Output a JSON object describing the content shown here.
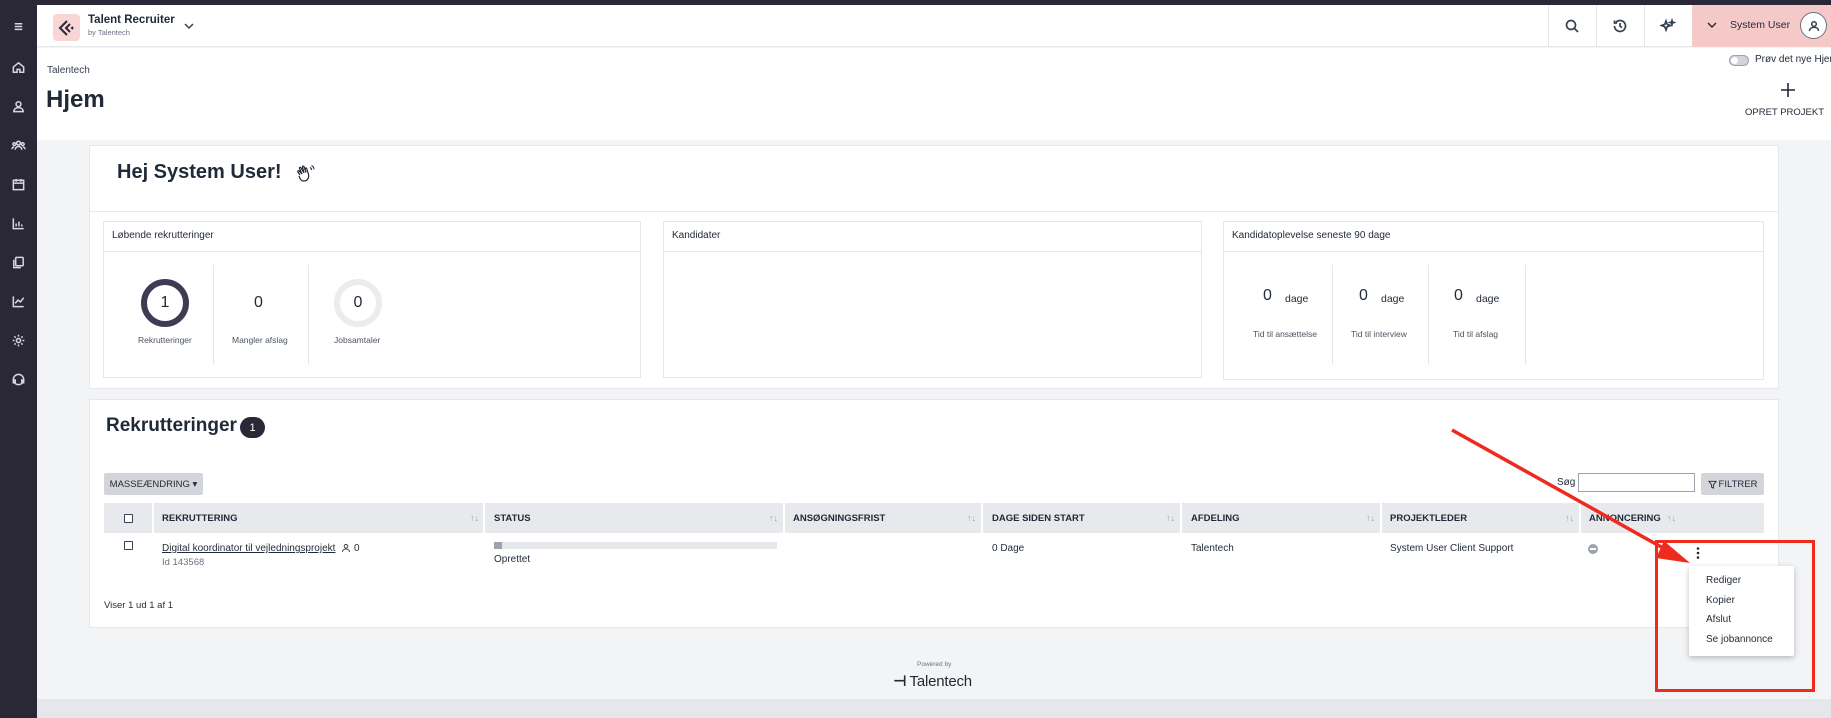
{
  "app": {
    "name": "Talent Recruiter",
    "sub": "by Talentech",
    "user_name": "System User"
  },
  "header": {
    "breadcrumb": "Talentech",
    "title": "Hjem",
    "toggle_label": "Prøv det nye Hjem",
    "create_label": "OPRET PROJEKT"
  },
  "welcome": {
    "greeting": "Hej System User!",
    "panels": {
      "ongoing": {
        "title": "Løbende rekrutteringer",
        "recruitments_value": "1",
        "recruitments_label": "Rekrutteringer",
        "missing_value": "0",
        "missing_label": "Mangler afslag",
        "interviews_value": "0",
        "interviews_label": "Jobsamtaler"
      },
      "candidates": {
        "title": "Kandidater"
      },
      "experience": {
        "title": "Kandidatoplevelse seneste 90 dage",
        "stats": [
          {
            "value": "0",
            "unit": "dage",
            "label": "Tid til ansættelse"
          },
          {
            "value": "0",
            "unit": "dage",
            "label": "Tid til interview"
          },
          {
            "value": "0",
            "unit": "dage",
            "label": "Tid til afslag"
          }
        ]
      }
    }
  },
  "recruitments": {
    "title": "Rekrutteringer",
    "count": "1",
    "mass_edit_label": "MASSEÆNDRING ▾",
    "search_label": "Søg",
    "search_value": "",
    "filter_label": "FILTRER",
    "columns": [
      "REKRUTTERING",
      "STATUS",
      "ANSØGNINGSFRIST",
      "DAGE SIDEN START",
      "AFDELING",
      "PROJEKTLEDER",
      "ANNONCERING"
    ],
    "rows": [
      {
        "name": "Digital koordinator til vejledningsprojekt",
        "candidates": "0",
        "id": "Id 143568",
        "status": "Oprettet",
        "progress": 0.03,
        "deadline": "",
        "days": "0 Dage",
        "department": "Talentech",
        "manager": "System User Client Support"
      }
    ],
    "footer": "Viser 1 ud 1 af 1"
  },
  "context_menu": {
    "items": [
      "Rediger",
      "Kopier",
      "Afslut",
      "Se jobannonce"
    ]
  },
  "footer": {
    "powered_by": "Powered by",
    "brand": "Talentech"
  },
  "colors": {
    "sidebar": "#2a2837",
    "accent_pink": "#f6c9c9",
    "annotation_red": "#ef2a1e"
  },
  "icons": {
    "sidebar": [
      "menu-icon",
      "home-icon",
      "person-icon",
      "group-icon",
      "calendar-icon",
      "chart-icon",
      "documents-icon",
      "analytics-icon",
      "settings-icon",
      "support-icon"
    ],
    "topbar": [
      "search-icon",
      "history-icon",
      "sparkle-icon"
    ]
  }
}
